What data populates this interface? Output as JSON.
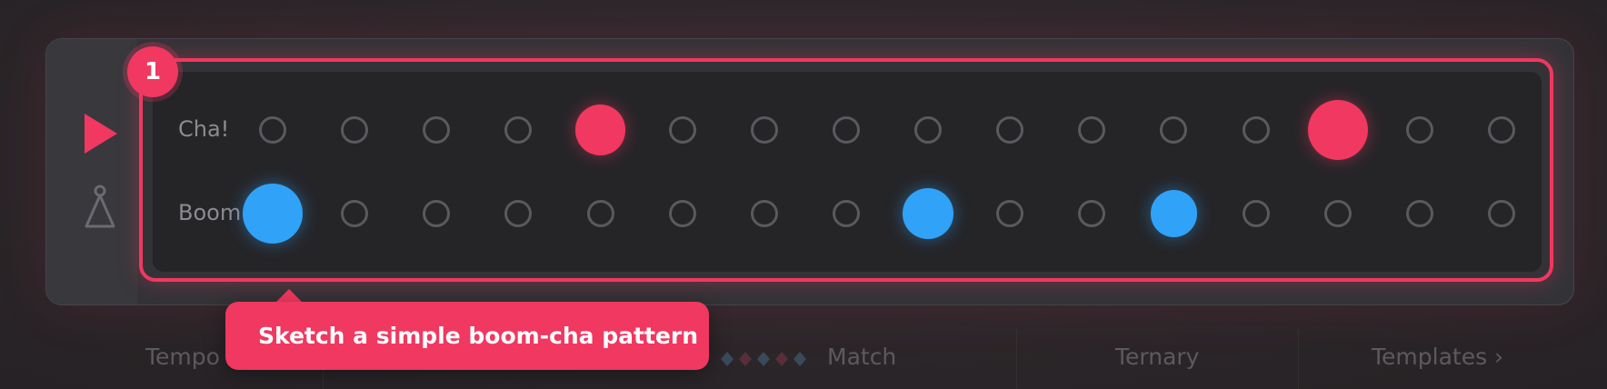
{
  "step_badge": "1",
  "rows": [
    {
      "label": "Cha!",
      "color": "#f03860",
      "steps": [
        0,
        0,
        0,
        0,
        0.6,
        0,
        0,
        0,
        0,
        0,
        0,
        0,
        0,
        1,
        0,
        0
      ]
    },
    {
      "label": "Boom",
      "color": "#30a2f8",
      "steps": [
        1,
        0,
        0,
        0,
        0,
        0,
        0,
        0,
        0.6,
        0,
        0,
        0.45,
        0,
        0,
        0,
        0
      ]
    }
  ],
  "tooltip": "Sketch a simple boom-cha pattern",
  "bottom_bar": {
    "tempo": "Tempo",
    "match": "Match",
    "ternary": "Ternary",
    "templates": "Templates ›"
  },
  "icons": {
    "play": "play-icon",
    "metronome": "metronome-icon",
    "diamonds": "diamond-pattern-icon"
  },
  "colors": {
    "accent": "#f03860",
    "blue": "#30a2f8",
    "inactive": "#5a595e"
  }
}
